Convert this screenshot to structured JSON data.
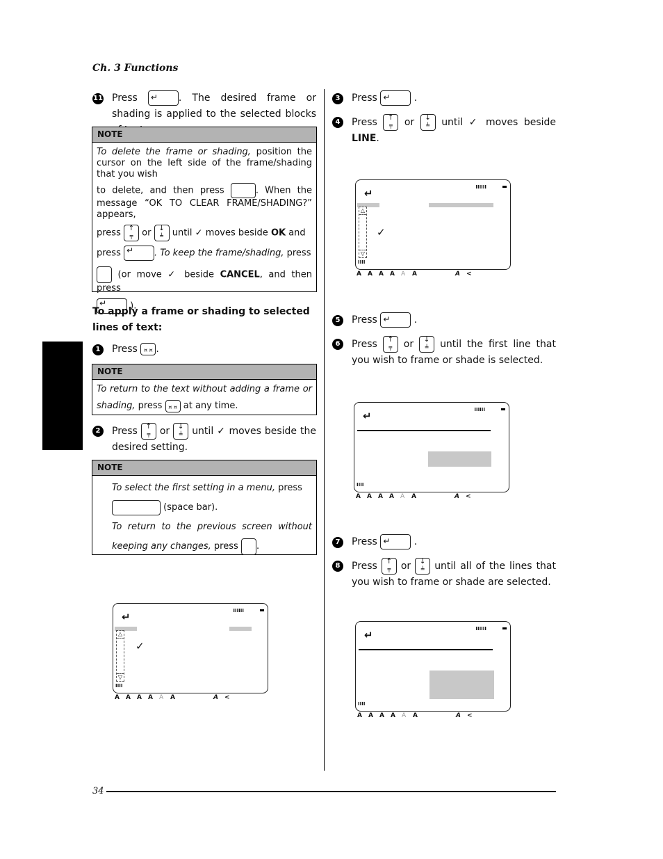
{
  "header": {
    "chapter": "Ch. 3 Functions"
  },
  "footer": {
    "page_number": "34"
  },
  "left_column": {
    "step11": {
      "number": "11",
      "press": "Press",
      "text": ". The desired frame or shading is applied to the selected blocks of text."
    },
    "note1": {
      "title": "NOTE",
      "p1_italic": "To delete the frame or shading,",
      "p1": " position the cursor on the left side of the frame/shading that you wish",
      "p2a": "to delete, and then press",
      "p2b": ". When the message “OK TO CLEAR FRAME/SHADING?” appears,",
      "p3a": "press",
      "p3_or": "or",
      "p3b": "until ✓ moves beside",
      "p3_bold": "OK",
      "p3c": "and",
      "p4a": "press",
      "p4_italic": ". To keep the frame/shading,",
      "p4b": "press",
      "p5a": "(or move ✓ beside",
      "p5_bold": "CANCEL",
      "p5b": ", and then press",
      "p6": ")."
    },
    "subheading": "To apply a frame or shading to selected lines of text:",
    "step1": {
      "number": "1",
      "press": "Press",
      "end": "."
    },
    "note2": {
      "title": "NOTE",
      "italic": "To return to the text without adding a frame or shading,",
      "a": " press",
      "b": "at any time."
    },
    "step2": {
      "number": "2",
      "press": "Press",
      "or": "or",
      "text": "until ✓ moves beside the desired setting."
    },
    "note3": {
      "title": "NOTE",
      "l1_italic": "To select the first setting in a menu,",
      "l1": " press",
      "l2": "(space bar).",
      "l3_italic": "To return to the previous screen without keeping any changes,",
      "l3": " press",
      "l3_end": "."
    }
  },
  "right_column": {
    "step3": {
      "number": "3",
      "press": "Press",
      "end": "."
    },
    "step4": {
      "number": "4",
      "press": "Press",
      "or": "or",
      "text": "until ✓ moves beside",
      "bold": "LINE",
      "end": "."
    },
    "step5": {
      "number": "5",
      "press": "Press",
      "end": "."
    },
    "step6": {
      "number": "6",
      "press": "Press",
      "or": "or",
      "text": "until the first line that you wish to frame or shade is selected."
    },
    "step7": {
      "number": "7",
      "press": "Press",
      "end": "."
    },
    "step8": {
      "number": "8",
      "press": "Press",
      "or": "or",
      "text": "until all of the lines that you wish to frame or shade are selected."
    }
  },
  "keys": {
    "enter_glyph": "↵",
    "up_glyph": "↑",
    "up_sub": "╤",
    "down_glyph": "↓",
    "down_sub": "╧",
    "code_glyph": "¤ ¤"
  },
  "lcd": {
    "enter_icon": "↵",
    "top_bars": "IIIIII",
    "left_bars": "IIII",
    "check": "✓",
    "up": "△",
    "down": "▽",
    "indicators": [
      "A",
      "A",
      "A",
      "A",
      "A",
      "A",
      "A",
      "<"
    ]
  }
}
